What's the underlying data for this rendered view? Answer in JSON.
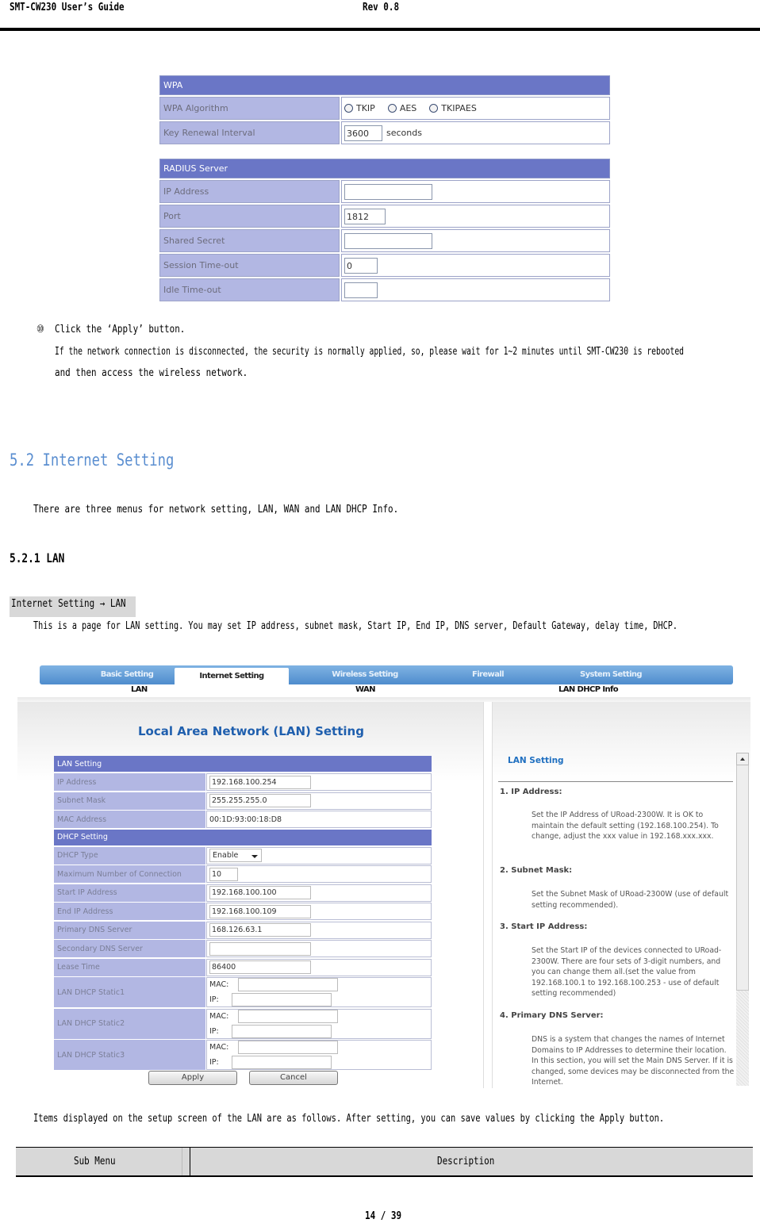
{
  "header": {
    "title": "SMT-CW230 User’s Guide",
    "revision": "Rev 0.8"
  },
  "wpa": {
    "section_title": "WPA",
    "algorithm_label": "WPA Algorithm",
    "algorithm_options": [
      "TKIP",
      "AES",
      "TKIPAES"
    ],
    "renewal_label": "Key Renewal Interval",
    "renewal_value": "3600",
    "renewal_unit": "seconds"
  },
  "radius": {
    "section_title": "RADIUS Server",
    "rows": [
      {
        "label": "IP Address",
        "value": ""
      },
      {
        "label": "Port",
        "value": "1812"
      },
      {
        "label": "Shared Secret",
        "value": ""
      },
      {
        "label": "Session Time-out",
        "value": "0"
      },
      {
        "label": "Idle Time-out",
        "value": ""
      }
    ]
  },
  "step": {
    "number": "⑩",
    "line1": "Click the  ‘Apply’  button.",
    "line2": "If the network connection is disconnected, the security is normally applied, so, please wait for 1~2 minutes until SMT-CW230 is rebooted",
    "line3": "and then access the wireless network."
  },
  "section": {
    "heading": "5.2 Internet Setting",
    "intro": "There are three menus for network setting, LAN, WAN and LAN DHCP Info.",
    "subheading": "5.2.1 LAN",
    "breadcrumb": "Internet Setting → LAN",
    "description": "This is a page for LAN setting. You may set IP address, subnet mask, Start IP, End IP, DNS server, Default Gateway, delay time, DHCP."
  },
  "screenshot": {
    "tabs": [
      "Basic Setting",
      "Internet Setting",
      "Wireless Setting",
      "Firewall",
      "System Setting"
    ],
    "active_tab": "Internet Setting",
    "subnav": [
      "LAN",
      "WAN",
      "LAN DHCP Info"
    ],
    "page_title": "Local Area Network (LAN) Setting",
    "lan_setting": {
      "title": "LAN Setting",
      "rows": [
        {
          "label": "IP Address",
          "value": "192.168.100.254"
        },
        {
          "label": "Subnet Mask",
          "value": "255.255.255.0"
        },
        {
          "label": "MAC Address",
          "value": "00:1D:93:00:18:D8"
        }
      ]
    },
    "dhcp_setting": {
      "title": "DHCP Setting",
      "type_label": "DHCP Type",
      "type_value": "Enable",
      "rows": [
        {
          "label": "Maximum Number of Connection",
          "value": "10"
        },
        {
          "label": "Start IP Address",
          "value": "192.168.100.100"
        },
        {
          "label": "End IP Address",
          "value": "192.168.100.109"
        },
        {
          "label": "Primary DNS Server",
          "value": "168.126.63.1"
        },
        {
          "label": "Secondary DNS Server",
          "value": ""
        },
        {
          "label": "Lease Time",
          "value": "86400"
        }
      ],
      "statics": [
        {
          "label": "LAN DHCP Static1",
          "mac_label": "MAC:",
          "ip_label": "IP:",
          "mac": "",
          "ip": ""
        },
        {
          "label": "LAN DHCP Static2",
          "mac_label": "MAC:",
          "ip_label": "IP:",
          "mac": "",
          "ip": ""
        },
        {
          "label": "LAN DHCP Static3",
          "mac_label": "MAC:",
          "ip_label": "IP:",
          "mac": "",
          "ip": ""
        }
      ]
    },
    "apply_label": "Apply",
    "cancel_label": "Cancel",
    "help": {
      "title": "LAN Setting",
      "items": [
        {
          "heading": "1. IP Address:",
          "text": "Set the IP Address of URoad-2300W. It is OK to maintain the default setting (192.168.100.254). To change, adjust the xxx value in 192.168.xxx.xxx."
        },
        {
          "heading": "2. Subnet Mask:",
          "text": "Set the Subnet Mask of URoad-2300W (use of default setting recommended)."
        },
        {
          "heading": "3. Start IP Address:",
          "text": "Set the Start IP of the devices connected to URoad-2300W. There are four sets of 3-digit numbers, and you can change them all.(set the value from 192.168.100.1 to 192.168.100.253 - use of default setting recommended)"
        },
        {
          "heading": "4. Primary DNS Server:",
          "text": "DNS is a system that changes the names of Internet Domains to IP Addresses to determine their location. In this section, you will set the Main DNS Server. If it is changed, some devices may be disconnected from the Internet."
        }
      ]
    }
  },
  "items_note": "Items displayed on the setup screen of the LAN are as follows. After setting, you can save values by clicking the Apply button.",
  "table": {
    "headers": [
      "Sub Menu",
      "Description"
    ]
  },
  "footer": {
    "page": "14 / 39"
  }
}
